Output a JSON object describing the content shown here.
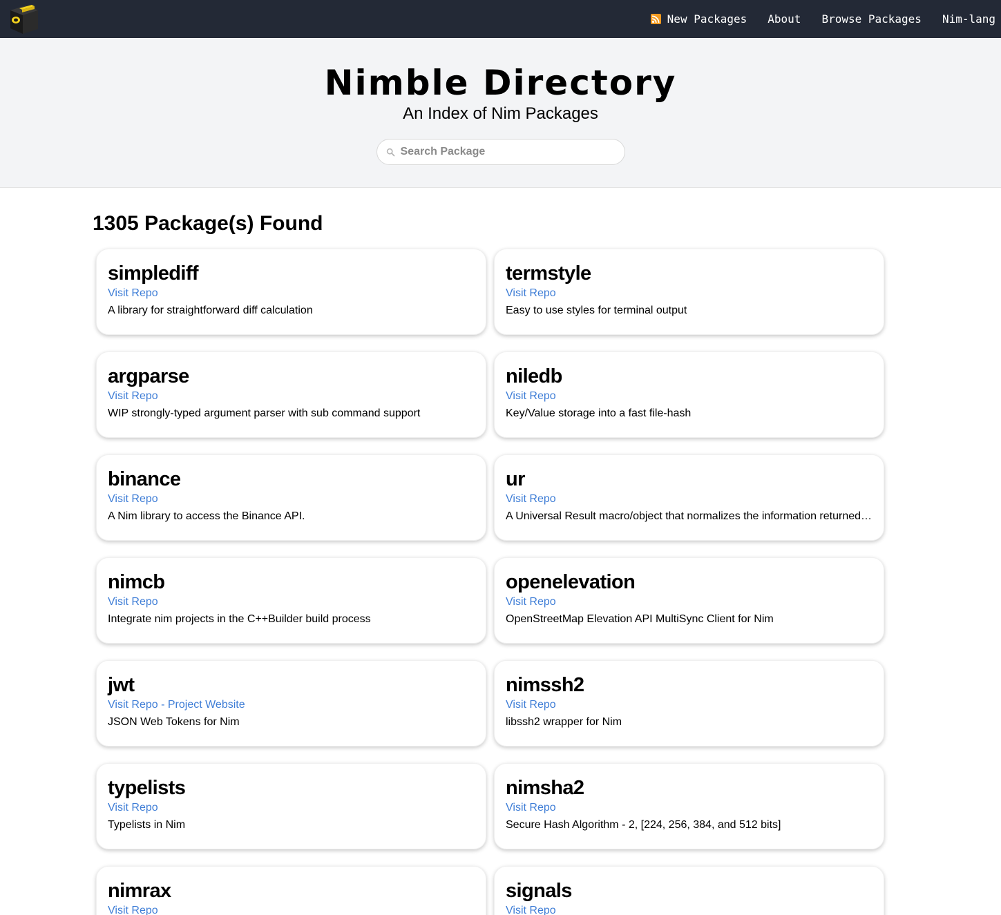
{
  "nav": {
    "new_packages": "New Packages",
    "about": "About",
    "browse_packages": "Browse Packages",
    "nim_lang": "Nim-lang"
  },
  "hero": {
    "title": "Nimble Directory",
    "subtitle": "An Index of Nim Packages",
    "search_placeholder": "Search Package"
  },
  "results": {
    "count": "1305",
    "label": " Package(s) Found"
  },
  "colors": {
    "topbar": "#232936",
    "link": "#3e7dd6",
    "rss": "#f49b21",
    "logo_accent": "#f5d31e"
  },
  "packages": [
    {
      "name": "simplediff",
      "repo_label": "Visit Repo",
      "desc": "A library for straightforward diff calculation"
    },
    {
      "name": "termstyle",
      "repo_label": "Visit Repo",
      "desc": "Easy to use styles for terminal output"
    },
    {
      "name": "argparse",
      "repo_label": "Visit Repo",
      "desc": "WIP strongly-typed argument parser with sub command support"
    },
    {
      "name": "niledb",
      "repo_label": "Visit Repo",
      "desc": "Key/Value storage into a fast file-hash"
    },
    {
      "name": "binance",
      "repo_label": "Visit Repo",
      "desc": "A Nim library to access the Binance API."
    },
    {
      "name": "ur",
      "repo_label": "Visit Repo",
      "desc": "A Universal Result macro/object that normalizes the information returned from a procedure"
    },
    {
      "name": "nimcb",
      "repo_label": "Visit Repo",
      "desc": "Integrate nim projects in the C++Builder build process"
    },
    {
      "name": "openelevation",
      "repo_label": "Visit Repo",
      "desc": "OpenStreetMap Elevation API MultiSync Client for Nim"
    },
    {
      "name": "jwt",
      "repo_label": "Visit Repo",
      "separator": " - ",
      "website_label": "Project Website",
      "desc": "JSON Web Tokens for Nim"
    },
    {
      "name": "nimssh2",
      "repo_label": "Visit Repo",
      "desc": "libssh2 wrapper for Nim"
    },
    {
      "name": "typelists",
      "repo_label": "Visit Repo",
      "desc": "Typelists in Nim"
    },
    {
      "name": "nimsha2",
      "repo_label": "Visit Repo",
      "desc": "Secure Hash Algorithm - 2, [224, 256, 384, and 512 bits]"
    },
    {
      "name": "nimrax",
      "repo_label": "Visit Repo",
      "desc": ""
    },
    {
      "name": "signals",
      "repo_label": "Visit Repo",
      "desc": ""
    }
  ]
}
